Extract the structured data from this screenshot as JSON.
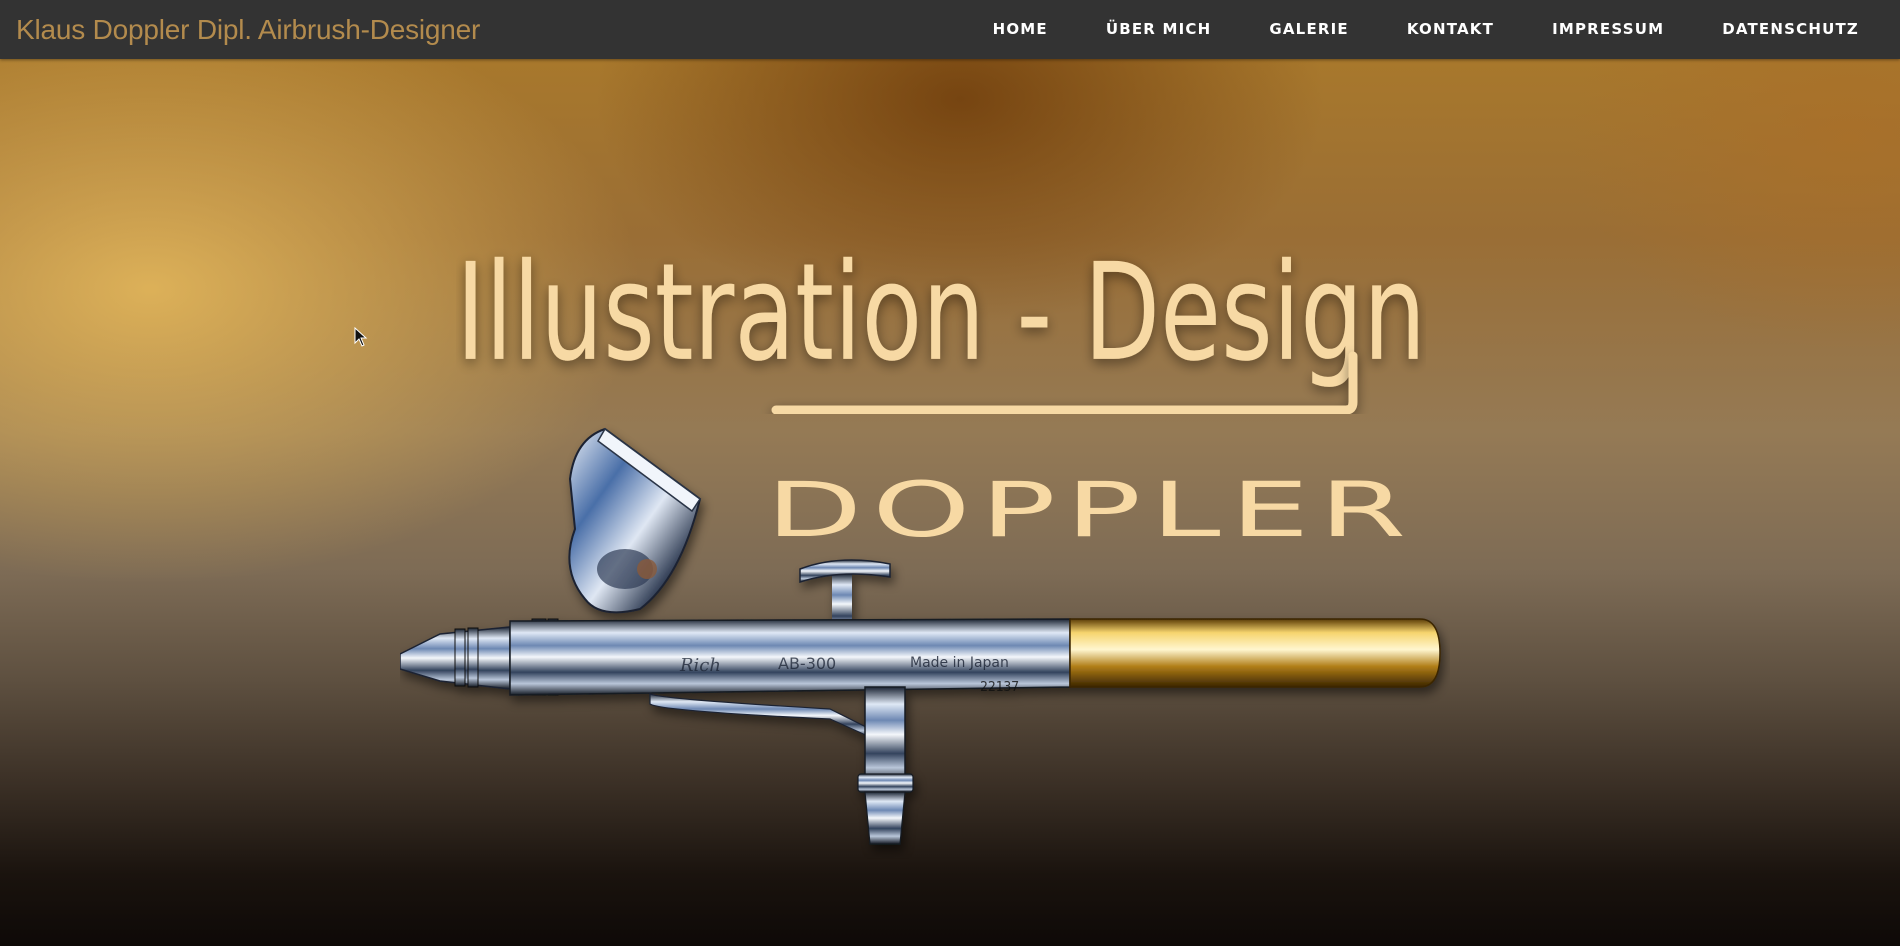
{
  "site": {
    "brand": "Klaus Doppler Dipl. Airbrush-Designer"
  },
  "nav": {
    "items": [
      {
        "label": "HOME"
      },
      {
        "label": "ÜBER MICH"
      },
      {
        "label": "GALERIE"
      },
      {
        "label": "KONTAKT"
      },
      {
        "label": "IMPRESSUM"
      },
      {
        "label": "DATENSCHUTZ"
      }
    ]
  },
  "hero": {
    "headline": "Illustration - Design",
    "wordmark": "DOPPLER",
    "airbrush_engravings": {
      "brand": "Rich",
      "model": "AB-300",
      "origin": "Made in Japan",
      "serial": "22137"
    }
  },
  "colors": {
    "topbar": "#333333",
    "brand_text": "#b38b4d",
    "nav_text": "#ffffff",
    "headline_text": "#f7d9a4",
    "gold": "#d6a43a"
  },
  "icons": {
    "cursor": "mouse-pointer-icon"
  }
}
